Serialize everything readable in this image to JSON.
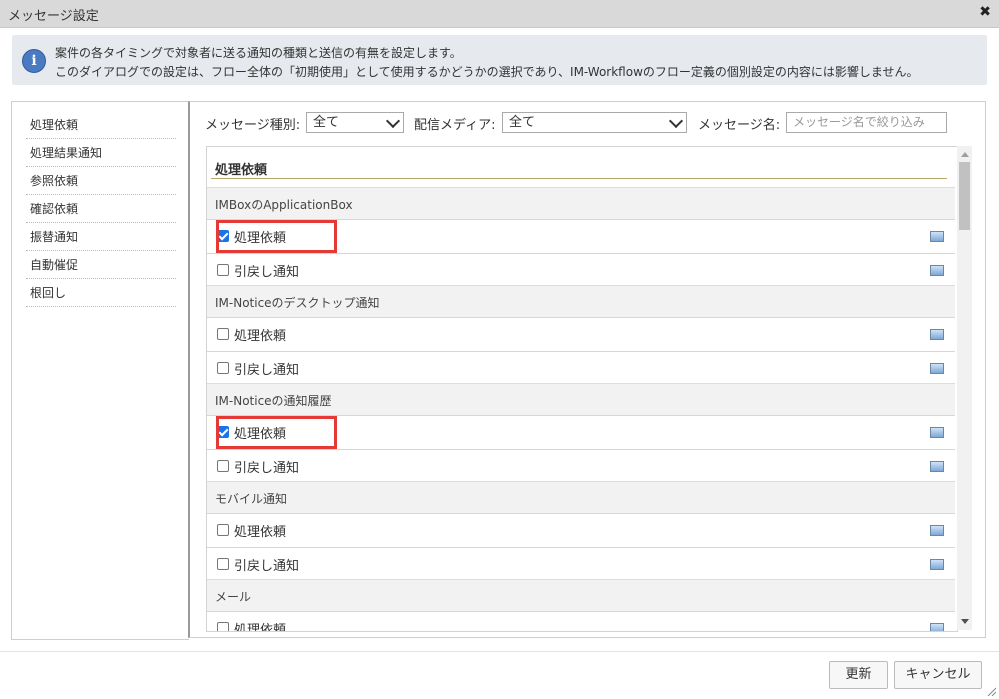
{
  "window": {
    "title": "メッセージ設定",
    "close_glyph": "✖"
  },
  "info": {
    "icon": "info-icon",
    "line1": "案件の各タイミングで対象者に送る通知の種類と送信の有無を設定します。",
    "line2": "このダイアログでの設定は、フロー全体の「初期使用」として使用するかどうかの選択であり、IM-Workflowのフロー定義の個別設定の内容には影響しません。"
  },
  "sidebar": {
    "items": [
      {
        "label": "処理依頼"
      },
      {
        "label": "処理結果通知"
      },
      {
        "label": "参照依頼"
      },
      {
        "label": "確認依頼"
      },
      {
        "label": "振替通知"
      },
      {
        "label": "自動催促"
      },
      {
        "label": "根回し"
      }
    ]
  },
  "filters": {
    "type_label": "メッセージ種別:",
    "type_value": "全て",
    "media_label": "配信メディア:",
    "media_value": "全て",
    "name_label": "メッセージ名:",
    "name_placeholder": "メッセージ名で絞り込み"
  },
  "list": {
    "section_title": "処理依頼",
    "groups": [
      {
        "title": "IMBoxのApplicationBox",
        "rows": [
          {
            "label": "処理依頼",
            "checked": true,
            "highlighted": true
          },
          {
            "label": "引戻し通知",
            "checked": false
          }
        ]
      },
      {
        "title": "IM-Noticeのデスクトップ通知",
        "rows": [
          {
            "label": "処理依頼",
            "checked": false
          },
          {
            "label": "引戻し通知",
            "checked": false
          }
        ]
      },
      {
        "title": "IM-Noticeの通知履歴",
        "rows": [
          {
            "label": "処理依頼",
            "checked": true,
            "highlighted": true
          },
          {
            "label": "引戻し通知",
            "checked": false
          }
        ]
      },
      {
        "title": "モバイル通知",
        "rows": [
          {
            "label": "処理依頼",
            "checked": false
          },
          {
            "label": "引戻し通知",
            "checked": false
          }
        ]
      },
      {
        "title": "メール",
        "rows": [
          {
            "label": "処理依頼",
            "checked": false
          }
        ]
      }
    ]
  },
  "footer": {
    "update_label": "更新",
    "cancel_label": "キャンセル"
  },
  "colors": {
    "highlight": "#e53935",
    "checkbox": "#1a73e8",
    "info_bg": "#e6e9ee"
  }
}
